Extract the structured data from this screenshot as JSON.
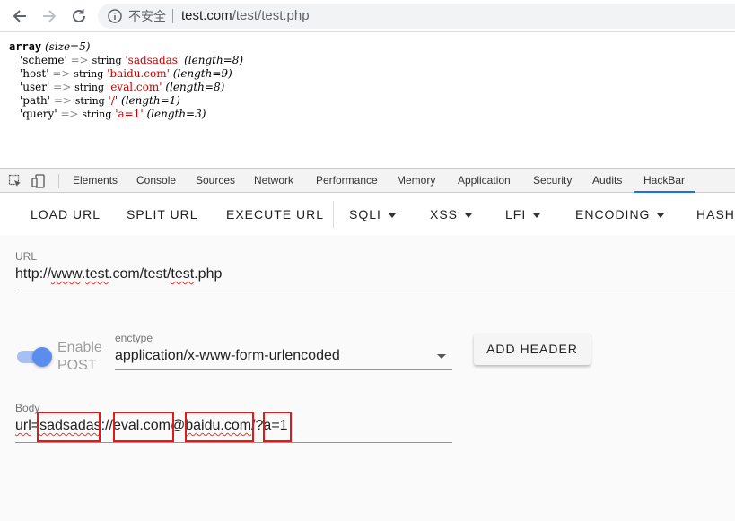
{
  "browser": {
    "insecure_label": "不安全",
    "url_host": "test.com",
    "url_path": "/test/test.php"
  },
  "dump": {
    "head_kw": "array",
    "head_size": "(size=5)",
    "rows": [
      {
        "key": "'scheme'",
        "arrow": "=>",
        "type": "string",
        "value": "'sadsadas'",
        "len": "(length=8)"
      },
      {
        "key": "'host'",
        "arrow": "=>",
        "type": "string",
        "value": "'baidu.com'",
        "len": "(length=9)"
      },
      {
        "key": "'user'",
        "arrow": "=>",
        "type": "string",
        "value": "'eval.com'",
        "len": "(length=8)"
      },
      {
        "key": "'path'",
        "arrow": "=>",
        "type": "string",
        "value": "'/'",
        "len": "(length=1)"
      },
      {
        "key": "'query'",
        "arrow": "=>",
        "type": "string",
        "value": "'a=1'",
        "len": "(length=3)"
      }
    ]
  },
  "devtools": {
    "tabs": [
      "Elements",
      "Console",
      "Sources",
      "Network",
      "Performance",
      "Memory",
      "Application",
      "Security",
      "Audits",
      "HackBar"
    ],
    "active_tab": "HackBar"
  },
  "hackbar": {
    "buttons": {
      "load_url": "LOAD URL",
      "split_url": "SPLIT URL",
      "execute_url": "EXECUTE URL",
      "sqli": "SQLI",
      "xss": "XSS",
      "lfi": "LFI",
      "encoding": "ENCODING",
      "hash": "HASH"
    },
    "url_label": "URL",
    "url_parts": [
      "http://",
      "www",
      ".",
      "test",
      ".com/test/",
      "test",
      ".php"
    ],
    "enable_post_label": "Enable POST",
    "enable_post": true,
    "enctype_label": "enctype",
    "enctype_value": "application/x-www-form-urlencoded",
    "add_header": "ADD HEADER",
    "body_label": "Body",
    "body_parts": [
      "url",
      "=",
      "sadsadas",
      "://",
      "eval.com",
      "@",
      "baidu.com",
      "/?",
      "a=1"
    ],
    "highlight_color": "#e0191b",
    "toggle_color": "#5b8def"
  }
}
